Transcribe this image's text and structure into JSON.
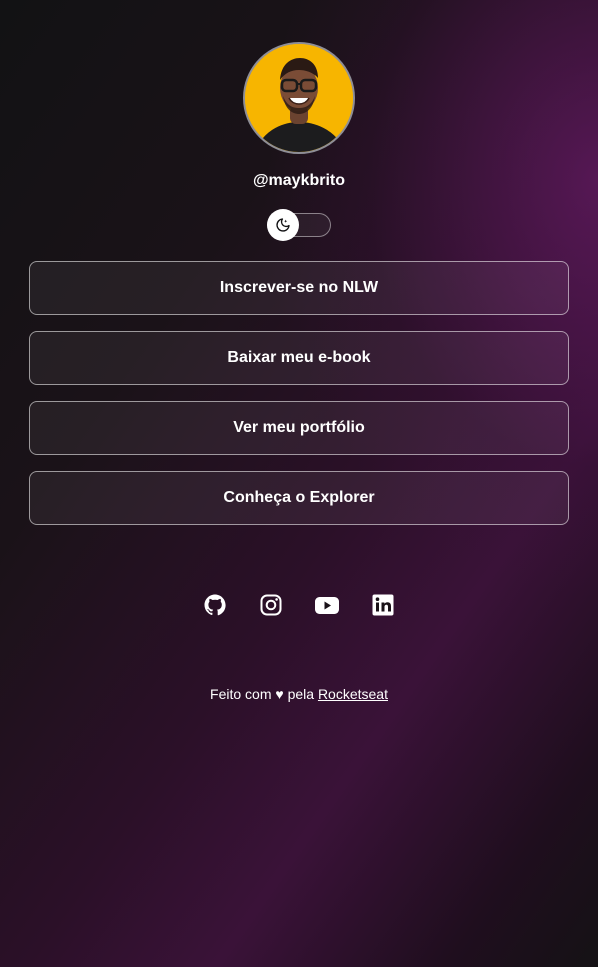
{
  "profile": {
    "username": "@maykbrito",
    "avatar_alt": "Foto de perfil",
    "avatar_bg": "#f7b500"
  },
  "theme_switch": {
    "icon": "moon-icon",
    "state": "dark"
  },
  "links": [
    {
      "label": "Inscrever-se no NLW"
    },
    {
      "label": "Baixar meu e-book"
    },
    {
      "label": "Ver meu portfólio"
    },
    {
      "label": "Conheça o Explorer"
    }
  ],
  "social": [
    {
      "icon": "github-icon"
    },
    {
      "icon": "instagram-icon"
    },
    {
      "icon": "youtube-icon"
    },
    {
      "icon": "linkedin-icon"
    }
  ],
  "footer": {
    "prefix": "Feito com",
    "heart": "♥",
    "middle": "pela",
    "brand": "Rocketseat"
  },
  "colors": {
    "text": "#ffffff",
    "accent_purple": "#3a1238"
  }
}
